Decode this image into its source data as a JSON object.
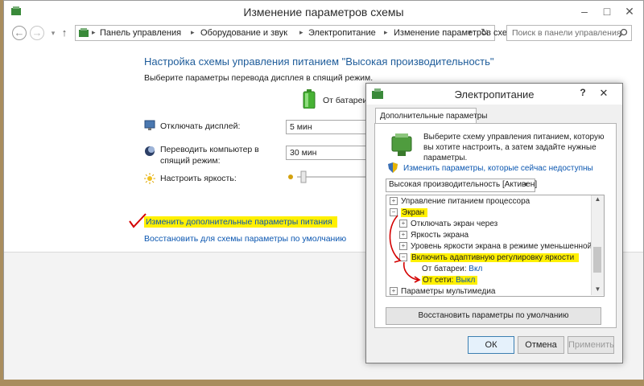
{
  "window": {
    "title": "Изменение параметров схемы",
    "minimize": "–",
    "maximize": "□",
    "close": "✕"
  },
  "nav": {
    "back": "←",
    "forward": "→",
    "dropdown": "▾",
    "up": "↑",
    "breadcrumbs": [
      "Панель управления",
      "Оборудование и звук",
      "Электропитание",
      "Изменение параметров схемы"
    ],
    "separator": "▸",
    "history": "▾",
    "refresh": "↻",
    "search_placeholder": "Поиск в панели управления"
  },
  "main": {
    "heading": "Настройка схемы управления питанием \"Высокая производительность\"",
    "subtitle": "Выберите параметры перевода дисплея в спящий режим.",
    "column_battery": "От батареи",
    "display_label": "Отключать дисплей:",
    "display_value": "5 мин",
    "sleep_label": "Переводить компьютер в спящий режим:",
    "sleep_value": "30 мин",
    "brightness_label": "Настроить яркость:",
    "link_advanced": "Изменить дополнительные параметры питания",
    "link_restore": "Восстановить для схемы параметры по умолчанию"
  },
  "dialog": {
    "title": "Электропитание",
    "help": "?",
    "close": "✕",
    "tab": "Дополнительные параметры",
    "description": "Выберите схему управления питанием, которую вы хотите настроить, а затем задайте нужные параметры.",
    "change_link": "Изменить параметры, которые сейчас недоступны",
    "plan_select": "Высокая производительность [Активен]",
    "tree": {
      "processor": "Управление питанием процессора",
      "screen": "Экран",
      "turn_off": "Отключать экран через",
      "brightness": "Яркость экрана",
      "dimmed": "Уровень яркости экрана в режиме уменьшенной яр",
      "adaptive": "Включить адаптивную регулировку яркости",
      "battery_label": "От батареи:",
      "battery_value": "Вкл",
      "ac_label": "От сети:",
      "ac_value": "Выкл",
      "multimedia": "Параметры мультимедиа"
    },
    "restore_button": "Восстановить параметры по умолчанию",
    "ok": "ОК",
    "cancel": "Отмена",
    "apply": "Применить"
  },
  "colors": {
    "link": "#0a56b0",
    "heading": "#1e5c9a",
    "highlight": "#fff000",
    "annotation": "#d40000"
  }
}
